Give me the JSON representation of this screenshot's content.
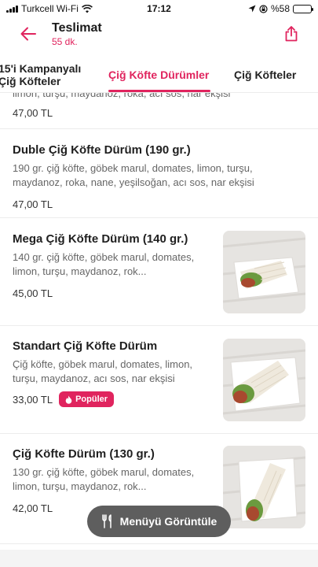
{
  "status": {
    "carrier": "Turkcell Wi-Fi",
    "time": "17:12",
    "battery": "%58",
    "battery_level": 0.58
  },
  "header": {
    "title": "Teslimat",
    "subtitle": "55 dk."
  },
  "tabs": [
    {
      "label": "15'i Kampanyalı\nÇiğ Köfteler"
    },
    {
      "label": "Çiğ Köfte Dürümler"
    },
    {
      "label": "Çiğ Köfteler"
    }
  ],
  "items": [
    {
      "name": "",
      "desc": "limon, turşu, maydanoz, roka, acı sos, nar ekşisi",
      "price": "47,00 TL"
    },
    {
      "name": "Duble Çiğ Köfte Dürüm (190 gr.)",
      "desc": "190 gr. çiğ köfte, göbek marul, domates, limon, turşu, maydanoz, roka, nane, yeşilsoğan, acı sos, nar ekşisi",
      "price": "47,00 TL"
    },
    {
      "name": "Mega Çiğ Köfte Dürüm (140 gr.)",
      "desc": "140 gr. çiğ köfte, göbek marul, domates, limon, turşu, maydanoz, rok...",
      "price": "45,00 TL"
    },
    {
      "name": "Standart Çiğ Köfte Dürüm",
      "desc": "Çiğ köfte, göbek marul, domates, limon, turşu, maydanoz, acı sos, nar ekşisi",
      "price": "33,00 TL",
      "badge": "Popüler"
    },
    {
      "name": "Çiğ Köfte Dürüm (130 gr.)",
      "desc": "130 gr. çiğ köfte, göbek marul, domates, limon, turşu, maydanoz, rok...",
      "price": "42,00 TL"
    }
  ],
  "menu_button": {
    "label": "Menüyü Görüntüle"
  },
  "colors": {
    "accent": "#e0245e",
    "fab": "#5e5e5e"
  }
}
